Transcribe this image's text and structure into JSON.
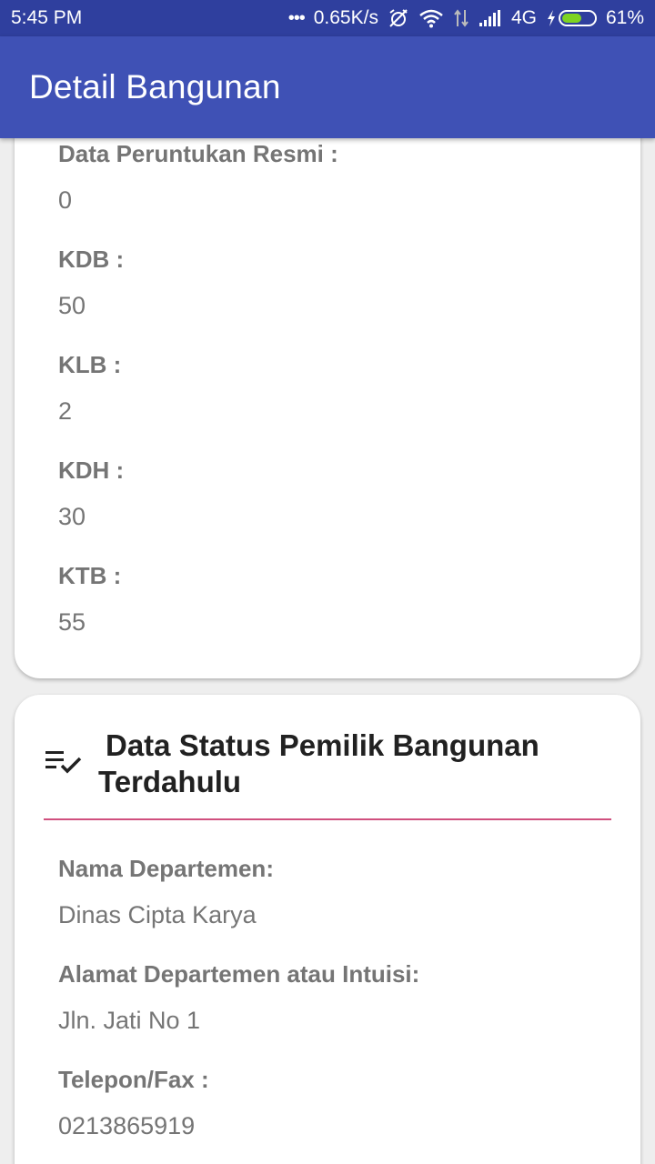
{
  "status_bar": {
    "time": "5:45 PM",
    "dots": "•••",
    "speed": "0.65K/s",
    "network": "4G",
    "battery": "61%",
    "battery_level": 0.61,
    "battery_color": "#7ed321"
  },
  "app_bar": {
    "title": "Detail Bangunan",
    "color": "#3f51b5"
  },
  "card1": {
    "fields": [
      {
        "label": "Data Peruntukan Resmi :",
        "value": "0"
      },
      {
        "label": "KDB :",
        "value": "50"
      },
      {
        "label": "KLB :",
        "value": "2"
      },
      {
        "label": "KDH :",
        "value": "30"
      },
      {
        "label": "KTB :",
        "value": "55"
      }
    ]
  },
  "card2": {
    "icon": "checklist-icon",
    "title": "Data Status Pemilik Bangunan Terdahulu",
    "divider_color": "#d0507e",
    "fields": [
      {
        "label": "Nama Departemen:",
        "value": "Dinas Cipta Karya"
      },
      {
        "label": "Alamat Departemen atau Intuisi:",
        "value": "Jln. Jati No 1"
      },
      {
        "label": "Telepon/Fax :",
        "value": "0213865919"
      }
    ]
  }
}
